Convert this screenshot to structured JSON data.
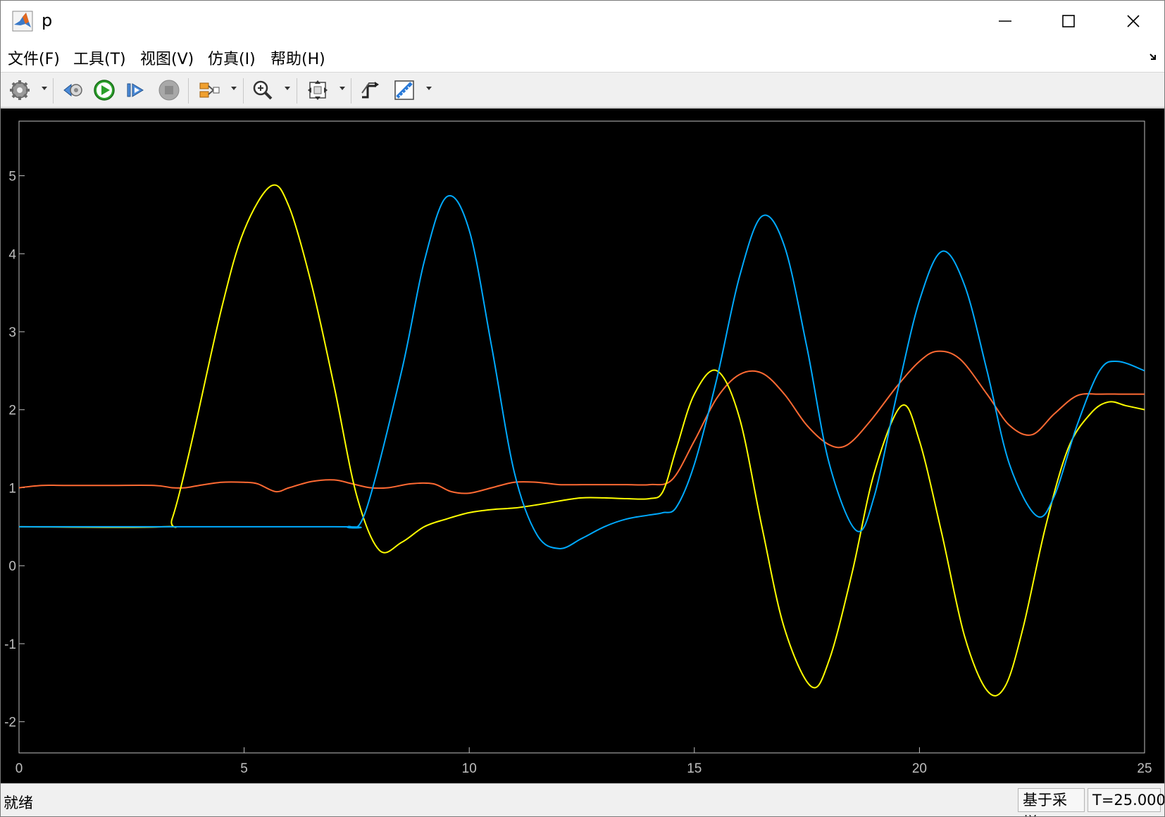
{
  "window": {
    "title": "p"
  },
  "menu": [
    {
      "id": "file",
      "label": "文件(F)"
    },
    {
      "id": "tools",
      "label": "工具(T)"
    },
    {
      "id": "view",
      "label": "视图(V)"
    },
    {
      "id": "simulation",
      "label": "仿真(I)"
    },
    {
      "id": "help",
      "label": "帮助(H)"
    }
  ],
  "toolbar": {
    "icons": [
      "gear-icon",
      "step-back-icon",
      "run-icon",
      "step-forward-icon",
      "stop-icon",
      "signal-selector-icon",
      "zoom-icon",
      "autoscale-icon",
      "triggers-icon",
      "measurements-icon"
    ]
  },
  "status": {
    "text": "就绪",
    "sampling": "基于采样",
    "time": "T=25.000"
  },
  "colors": {
    "background": "#000000",
    "grid": "#4d4d4d",
    "axis_text": "#bfbfbf",
    "series_yellow": "#ffff00",
    "series_blue": "#00aaff",
    "series_orange": "#ff6a33"
  },
  "chart_data": {
    "type": "line",
    "xlim": [
      0,
      25
    ],
    "ylim": [
      -2.4,
      5.7
    ],
    "x_ticks": [
      0,
      5,
      10,
      15,
      20,
      25
    ],
    "x_tick_labels": [
      "0",
      "5",
      "10",
      "15",
      "20",
      "25"
    ],
    "y_ticks": [
      -2,
      -1,
      0,
      1,
      2,
      3,
      4,
      5
    ],
    "y_tick_labels": [
      "-2",
      "-1",
      "0",
      "1",
      "2",
      "3",
      "4",
      "5"
    ],
    "grid": true,
    "series": [
      {
        "color": "#ffff00",
        "x": [
          0,
          3.2,
          3.4,
          3.8,
          4.5,
          5.0,
          5.6,
          6.0,
          6.5,
          7.0,
          7.5,
          8.0,
          8.5,
          9.0,
          9.5,
          10.0,
          10.5,
          11.0,
          11.5,
          12.0,
          12.5,
          13.0,
          13.5,
          14.0,
          14.3,
          14.6,
          15.0,
          15.5,
          16.0,
          16.5,
          17.0,
          17.6,
          18.0,
          18.5,
          19.0,
          19.6,
          20.0,
          20.5,
          21.0,
          21.5,
          21.9,
          22.3,
          22.8,
          23.3,
          23.8,
          24.2,
          24.6,
          25.0
        ],
        "y": [
          0.5,
          0.5,
          0.6,
          1.5,
          3.3,
          4.3,
          4.87,
          4.6,
          3.6,
          2.3,
          0.9,
          0.2,
          0.3,
          0.5,
          0.6,
          0.68,
          0.72,
          0.74,
          0.78,
          0.83,
          0.87,
          0.87,
          0.86,
          0.86,
          0.95,
          1.5,
          2.2,
          2.5,
          1.9,
          0.5,
          -0.8,
          -1.55,
          -1.2,
          -0.1,
          1.2,
          2.05,
          1.6,
          0.4,
          -0.9,
          -1.6,
          -1.55,
          -0.8,
          0.5,
          1.5,
          1.95,
          2.1,
          2.05,
          2.0
        ]
      },
      {
        "color": "#00aaff",
        "x": [
          0,
          7.0,
          7.3,
          7.7,
          8.5,
          9.0,
          9.5,
          10.0,
          10.5,
          11.0,
          11.5,
          12.0,
          12.5,
          13.0,
          13.5,
          14.0,
          14.3,
          14.6,
          15.0,
          15.5,
          16.0,
          16.5,
          17.0,
          17.5,
          18.0,
          18.6,
          19.0,
          19.5,
          20.0,
          20.5,
          21.0,
          21.5,
          22.0,
          22.6,
          23.0,
          23.5,
          24.0,
          24.4,
          25.0
        ],
        "y": [
          0.5,
          0.5,
          0.5,
          0.7,
          2.5,
          3.9,
          4.73,
          4.3,
          2.8,
          1.2,
          0.4,
          0.22,
          0.35,
          0.5,
          0.6,
          0.65,
          0.68,
          0.75,
          1.3,
          2.4,
          3.7,
          4.48,
          4.1,
          2.8,
          1.3,
          0.45,
          0.9,
          2.2,
          3.4,
          4.03,
          3.6,
          2.5,
          1.3,
          0.64,
          0.9,
          1.8,
          2.5,
          2.62,
          2.5
        ]
      },
      {
        "color": "#ff6a33",
        "x": [
          0,
          0.5,
          1,
          2,
          3,
          3.4,
          3.7,
          4,
          4.5,
          5,
          5.3,
          5.7,
          6,
          6.5,
          7,
          7.4,
          7.8,
          8.2,
          8.7,
          9.2,
          9.6,
          10,
          10.5,
          11,
          11.5,
          12,
          12.5,
          13,
          13.5,
          14,
          14.5,
          15,
          15.5,
          16,
          16.5,
          17,
          17.5,
          18,
          18.4,
          18.9,
          19.5,
          20,
          20.4,
          20.9,
          21.5,
          22,
          22.5,
          23,
          23.5,
          24,
          24.5,
          25
        ],
        "y": [
          1.0,
          1.03,
          1.03,
          1.03,
          1.03,
          1.0,
          1.0,
          1.03,
          1.07,
          1.07,
          1.05,
          0.95,
          1.0,
          1.08,
          1.1,
          1.05,
          1.0,
          1.0,
          1.05,
          1.05,
          0.95,
          0.93,
          1.0,
          1.07,
          1.07,
          1.04,
          1.04,
          1.04,
          1.04,
          1.04,
          1.1,
          1.6,
          2.15,
          2.45,
          2.47,
          2.2,
          1.8,
          1.55,
          1.55,
          1.85,
          2.3,
          2.62,
          2.75,
          2.65,
          2.2,
          1.8,
          1.68,
          1.95,
          2.18,
          2.2,
          2.2,
          2.2
        ]
      }
    ]
  }
}
